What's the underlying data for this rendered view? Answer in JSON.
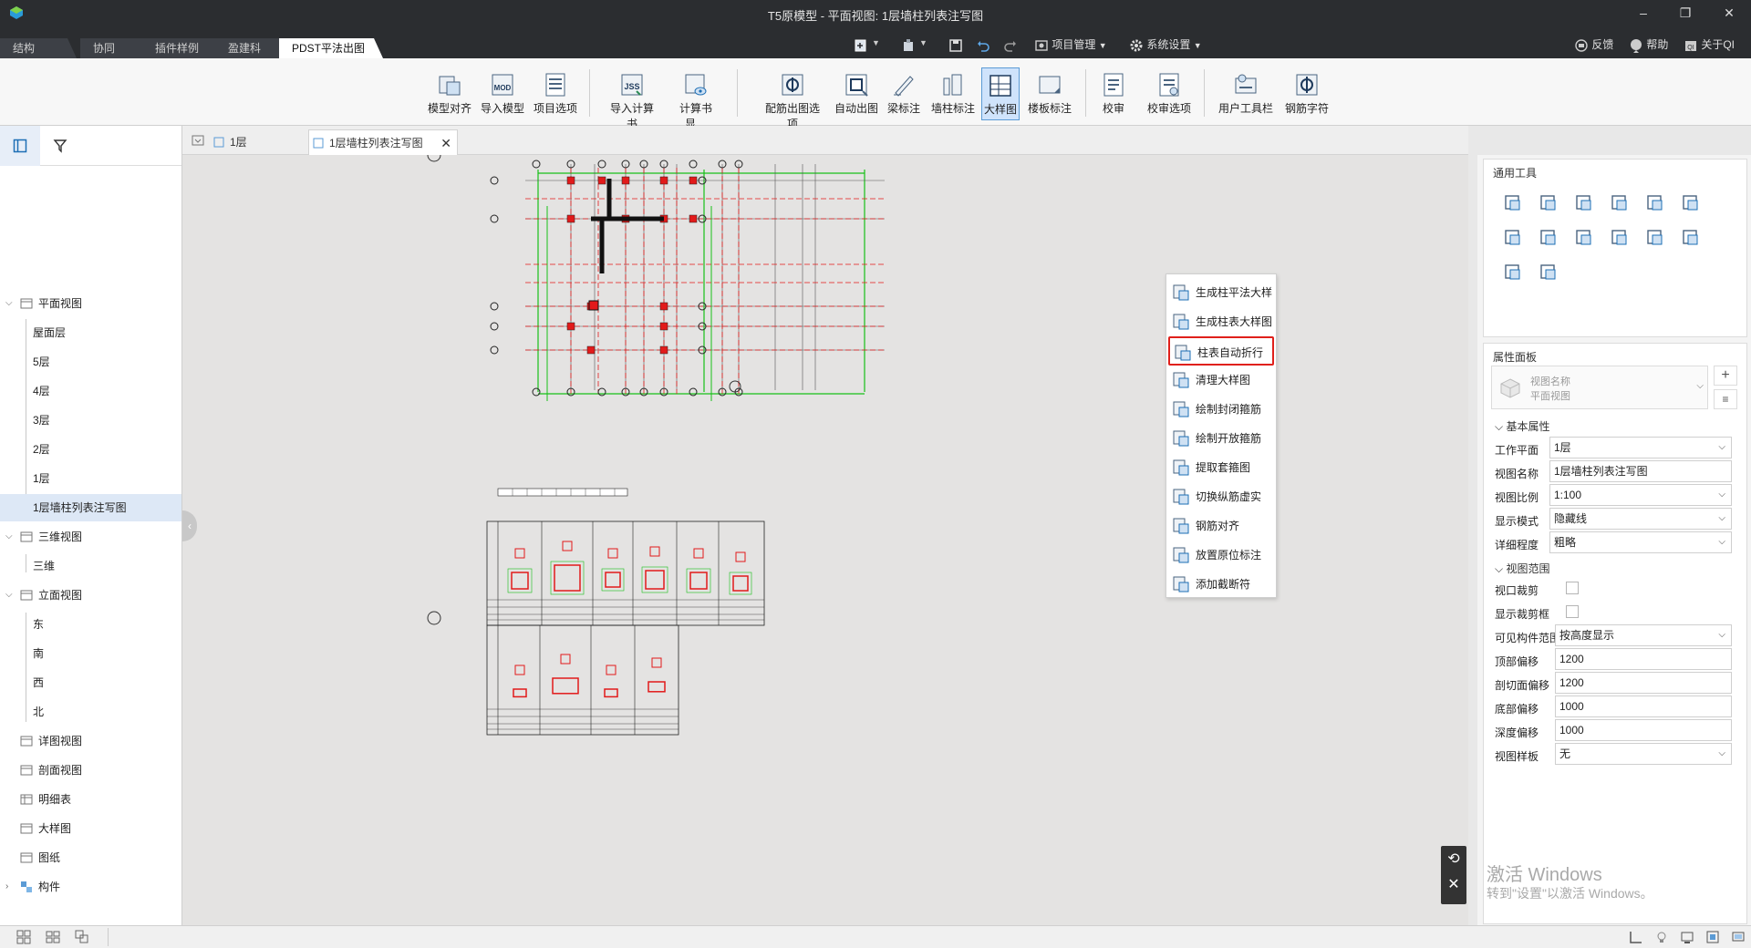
{
  "window": {
    "title": "T5原模型 - 平面视图: 1层墙柱列表注写图"
  },
  "ribbon_tabs": [
    "结构",
    "协同",
    "插件样例",
    "盈建科",
    "PDST平法出图"
  ],
  "quick_access": {
    "project_mgmt": "项目管理",
    "system_settings": "系统设置"
  },
  "top_right": {
    "feedback": "反馈",
    "help": "帮助",
    "about": "关于QI"
  },
  "ribbon_buttons": [
    "模型对齐",
    "导入模型",
    "项目选项",
    "导入计算书",
    "计算书显…",
    "配筋出图选项",
    "自动出图",
    "梁标注",
    "墙柱标注",
    "大样图",
    "楼板标注",
    "校审",
    "校审选项",
    "用户工具栏",
    "钢筋字符"
  ],
  "dropdown_items": [
    "生成柱平法大样",
    "生成柱表大样图",
    "柱表自动折行",
    "清理大样图",
    "绘制封闭箍筋",
    "绘制开放箍筋",
    "提取套箍图",
    "切换纵筋虚实",
    "钢筋对齐",
    "放置原位标注",
    "添加截断符"
  ],
  "tree": {
    "plan_views": "平面视图",
    "plan_children": [
      "屋面层",
      "5层",
      "4层",
      "3层",
      "2层",
      "1层",
      "1层墙柱列表注写图"
    ],
    "3d_views": "三维视图",
    "3d_children": [
      "三维"
    ],
    "elevation_views": "立面视图",
    "elevation_children": [
      "东",
      "南",
      "西",
      "北"
    ],
    "detail_views": "详图视图",
    "section_views": "剖面视图",
    "schedules": "明细表",
    "large_details": "大样图",
    "sheets": "图纸",
    "components": "构件"
  },
  "doc_tabs": [
    "1层",
    "1层墙柱列表注写图"
  ],
  "right_panel": {
    "tools_title": "通用工具",
    "props_title": "属性面板",
    "view_type_name": "视图名称",
    "view_type_sub": "平面视图",
    "basic_props": "基本属性",
    "props": [
      {
        "label": "工作平面",
        "value": "1层",
        "dropdown": true
      },
      {
        "label": "视图名称",
        "value": "1层墙柱列表注写图",
        "dropdown": false
      },
      {
        "label": "视图比例",
        "value": "1:100",
        "dropdown": true
      },
      {
        "label": "显示模式",
        "value": "隐藏线",
        "dropdown": true
      },
      {
        "label": "详细程度",
        "value": "粗略",
        "dropdown": true
      }
    ],
    "view_range": "视图范围",
    "checks": [
      "视口裁剪",
      "显示裁剪框"
    ],
    "range_props": [
      {
        "label": "可见构件范围",
        "value": "按高度显示",
        "dropdown": true
      },
      {
        "label": "顶部偏移",
        "value": "1200",
        "dropdown": false
      },
      {
        "label": "剖切面偏移",
        "value": "1200",
        "dropdown": false
      },
      {
        "label": "底部偏移",
        "value": "1000",
        "dropdown": false
      },
      {
        "label": "深度偏移",
        "value": "1000",
        "dropdown": false
      },
      {
        "label": "视图样板",
        "value": "无",
        "dropdown": true
      }
    ]
  },
  "watermark": {
    "line1": "激活 Windows",
    "line2": "转到\"设置\"以激活 Windows。"
  },
  "colors": {
    "accent": "#5b9bd5",
    "highlight": "#e0201b",
    "drawing_red": "#e21a1a",
    "drawing_green": "#18c018"
  }
}
